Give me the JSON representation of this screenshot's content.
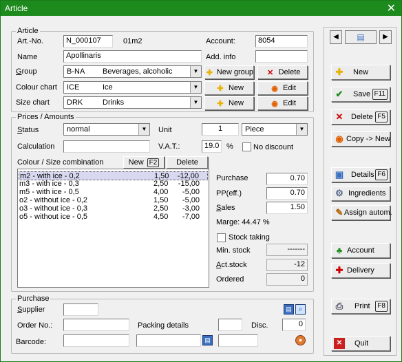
{
  "window": {
    "title": "Article",
    "close_glyph": "✕"
  },
  "article": {
    "legend": "Article",
    "artno_label": "Art.-No.",
    "artno_value": "N_000107",
    "artno_suffix": "01m2",
    "account_label": "Account:",
    "account_value": "8054",
    "name_label": "Name",
    "name_value": "Apollinaris",
    "addinfo_label": "Add. info",
    "addinfo_value": "",
    "group_label": "Group",
    "group_code": "B-NA",
    "group_text": "Beverages, alcoholic",
    "new_group_label": "New group",
    "delete_label": "Delete",
    "colour_label": "Colour chart",
    "colour_code": "ICE",
    "colour_text": "Ice",
    "size_label": "Size chart",
    "size_code": "DRK",
    "size_text": "Drinks",
    "new_label": "New",
    "edit_label": "Edit"
  },
  "prices": {
    "legend": "Prices / Amounts",
    "status_label": "Status",
    "status_value": "normal",
    "unit_label": "Unit",
    "unit_qty": "1",
    "unit_value": "Piece",
    "calc_label": "Calculation",
    "calc_value": "",
    "vat_label": "V.A.T.:",
    "vat_value": "19.0",
    "vat_unit": "%",
    "no_discount_label": "No discount",
    "cs_label": "Colour / Size combination",
    "cs_new_label": "New",
    "cs_new_key": "F2",
    "cs_delete_label": "Delete",
    "combinations": [
      {
        "name": "m2 - with ice - 0,2",
        "price": "1,50",
        "stock": "-12,00"
      },
      {
        "name": "m3 - with ice - 0,3",
        "price": "2,50",
        "stock": "-15,00"
      },
      {
        "name": "m5 - with ice - 0,5",
        "price": "4,00",
        "stock": "-5,00"
      },
      {
        "name": "o2 - without ice - 0,2",
        "price": "1,50",
        "stock": "-5,00"
      },
      {
        "name": "o3 - without ice - 0,3",
        "price": "2,50",
        "stock": "-3,00"
      },
      {
        "name": "o5 - without ice - 0,5",
        "price": "4,50",
        "stock": "-7,00"
      }
    ],
    "purchase_label": "Purchase",
    "purchase_value": "0.70",
    "ppeff_label": "PP(eff.)",
    "ppeff_value": "0.70",
    "sales_label": "Sales",
    "sales_value": "1.50",
    "marge_text": "Marge: 44.47 %",
    "stock_taking_label": "Stock taking",
    "min_stock_label": "Min. stock",
    "min_stock_value": "-------",
    "act_stock_label": "Act.stock",
    "act_stock_value": "-12",
    "ordered_label": "Ordered",
    "ordered_value": "0"
  },
  "purchase": {
    "legend": "Purchase",
    "supplier_label": "Supplier",
    "supplier_value": "",
    "order_label": "Order No.:",
    "order_value": "",
    "packing_label": "Packing details",
    "packing_value": "",
    "disc_label": "Disc.",
    "disc_value": "0",
    "barcode_label": "Barcode:",
    "barcode_value": "",
    "barcode_value2": "",
    "barcode_value3": ""
  },
  "side": {
    "new": "New",
    "save": "Save",
    "save_key": "F11",
    "delete": "Delete",
    "delete_key": "F5",
    "copy": "Copy -> New",
    "details": "Details",
    "details_key": "F6",
    "ingredients": "Ingredients",
    "assign": "Assign autom.",
    "account": "Account",
    "delivery": "Delivery",
    "print": "Print",
    "print_key": "F8",
    "quit": "Quit"
  },
  "colors": {
    "title_bar": "#1d8a1d",
    "selection": "#d8d8f0",
    "accent_red": "#cc0000",
    "accent_green": "#1a8a1a"
  }
}
